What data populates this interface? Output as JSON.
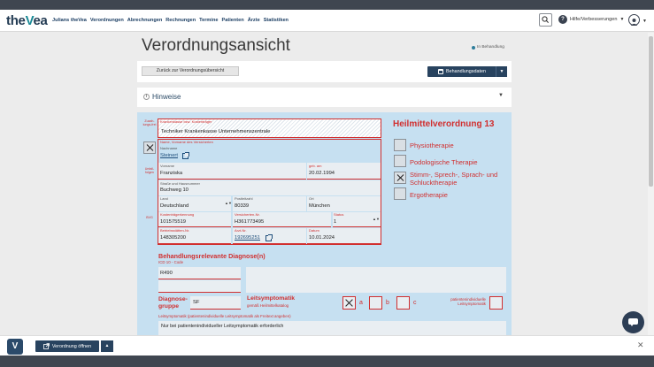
{
  "header": {
    "logo_prefix": "the",
    "logo_v": "V",
    "logo_suffix": "ea",
    "nav": [
      "Julians theVea",
      "Verordnungen",
      "Abrechnungen",
      "Rechnungen",
      "Termine",
      "Patienten",
      "Ärzte",
      "Statistiken"
    ],
    "help_label": "Hilfe/Verbesserungen",
    "help_glyph": "?"
  },
  "page": {
    "title": "Verordnungsansicht",
    "status": "In Behandlung",
    "back_button": "Zurück zur Verordnungsübersicht",
    "treatment_button": "Behandlungsdaten",
    "hints_title": "Hinweise"
  },
  "form": {
    "side_labels": {
      "zuzahlung": "Zuzah-lungs-frei",
      "unfall": "Unfall-folgen",
      "bvg": "BVG"
    },
    "insurance_label": "Krankenkasse bzw. Kostenträger",
    "insurance_value": "Techniker Krankenkasse Unternehmenszentrale",
    "patient_label": "Name, Vorname des Versicherten",
    "lastname_label": "Nachname",
    "lastname_value": "Steinert",
    "firstname_label": "Vorname",
    "firstname_value": "Franziska",
    "birth_label": "geb. am",
    "birth_value": "20.02.1994",
    "street_label": "Straße und Hausnummer",
    "street_value": "Buchweg 10",
    "country_label": "Land",
    "country_value": "Deutschland",
    "zip_label": "Postleitzahl",
    "zip_value": "80339",
    "city_label": "Ort",
    "city_value": "München",
    "cost_id_label": "Kostenträgerkennung",
    "cost_id_value": "101575519",
    "insured_no_label": "Versicherten-Nr.",
    "insured_no_value": "H361773495",
    "status_label": "Status",
    "status_value": "1",
    "bsnr_label": "Betriebsstätten-Nr.",
    "bsnr_value": "148305200",
    "lanr_label": "Arzt-Nr.",
    "lanr_value": "192695251",
    "date_label": "Datum",
    "date_value": "10.01.2024",
    "prescription_title": "Heilmittelverordnung 13",
    "therapies": [
      {
        "label": "Physiotherapie",
        "checked": false
      },
      {
        "label": "Podologische Therapie",
        "checked": false
      },
      {
        "label": "Stimm-, Sprech-, Sprach- und Schlucktherapie",
        "checked": true
      },
      {
        "label": "Ergotherapie",
        "checked": false
      }
    ],
    "diagnosis_title": "Behandlungsrelevante Diagnose(n)",
    "icd_label": "ICD 10 - Code",
    "icd_value": "R490",
    "diagnosis_group_label": "Diagnose-gruppe",
    "diagnosis_group_value": "SF",
    "leitsymptomatik_label": "Leitsymptomatik",
    "leitsymptomatik_sub": "gemäß Heilmittelkatalog",
    "option_a": "a",
    "option_b": "b",
    "option_c": "c",
    "individual_label": "patientenindividuelle Leitsymptomatik",
    "free_text_label": "Leitsymptomatik (patientenindividuelle Leitsymptomatik als Freitext angeben)",
    "free_text_value": "Nur bei patientenindividueller Leitsymptomatik erforderlich"
  },
  "bottom": {
    "logo_glyph": "V",
    "open_button": "Verordnung öffnen",
    "close_glyph": "✕"
  },
  "colors": {
    "form_red": "#d12f2f",
    "form_background": "#c6e0f1",
    "button_navy": "#28435f"
  }
}
